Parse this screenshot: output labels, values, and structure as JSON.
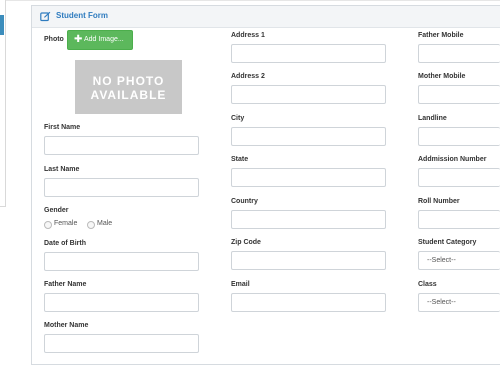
{
  "panel": {
    "title": "Student Form"
  },
  "photo": {
    "label": "Photo",
    "add_button": "Add Image...",
    "placeholder_line1": "NO PHOTO",
    "placeholder_line2": "AVAILABLE"
  },
  "column1": {
    "first_name": "First Name",
    "last_name": "Last Name",
    "gender": "Gender",
    "gender_options": [
      "Female",
      "Male"
    ],
    "date_of_birth": "Date of Birth",
    "father_name": "Father Name",
    "mother_name": "Mother Name"
  },
  "column2": {
    "address1": "Address 1",
    "address2": "Address 2",
    "city": "City",
    "state": "State",
    "country": "Country",
    "zip_code": "Zip Code",
    "email": "Email"
  },
  "column3": {
    "father_mobile": "Father Mobile",
    "mother_mobile": "Mother Mobile",
    "landline": "Landline",
    "admission_number": "Addmission Number",
    "roll_number": "Roll Number",
    "student_category": "Student Category",
    "student_category_value": "--Select--",
    "class": "Class",
    "class_value": "--Select--"
  },
  "colors": {
    "accent": "#2f7cbf",
    "add_button": "#5cb85c",
    "photo_placeholder": "#c8c8c8"
  }
}
